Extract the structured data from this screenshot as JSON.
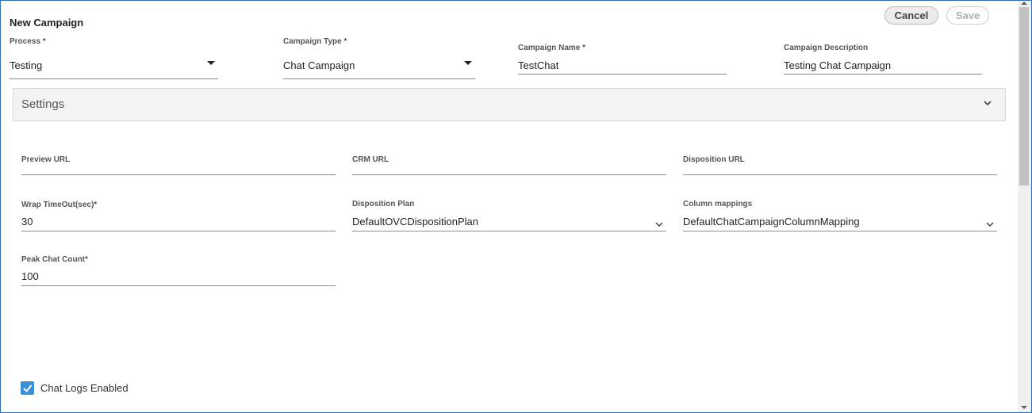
{
  "header": {
    "title": "New Campaign",
    "cancel_label": "Cancel",
    "save_label": "Save"
  },
  "top_fields": {
    "process": {
      "label": "Process *",
      "value": "Testing"
    },
    "campaign_type": {
      "label": "Campaign Type *",
      "value": "Chat Campaign"
    },
    "campaign_name": {
      "label": "Campaign Name *",
      "value": "TestChat"
    },
    "campaign_description": {
      "label": "Campaign Description",
      "value": "Testing Chat Campaign"
    }
  },
  "settings": {
    "title": "Settings",
    "preview_url": {
      "label": "Preview URL",
      "value": ""
    },
    "crm_url": {
      "label": "CRM URL",
      "value": ""
    },
    "disposition_url": {
      "label": "Disposition URL",
      "value": ""
    },
    "wrap_timeout": {
      "label": "Wrap TimeOut(sec)*",
      "value": "30"
    },
    "disposition_plan": {
      "label": "Disposition Plan",
      "value": "DefaultOVCDispositionPlan"
    },
    "column_mappings": {
      "label": "Column mappings",
      "value": "DefaultChatCampaignColumnMapping"
    },
    "peak_chat_count": {
      "label": "Peak Chat Count*",
      "value": "100"
    }
  },
  "chat_logs": {
    "label": "Chat Logs Enabled",
    "checked": true
  },
  "colors": {
    "accent": "#3a8fd6",
    "frame_border": "#2f6fb7",
    "settings_bg": "#f3f3f3"
  }
}
